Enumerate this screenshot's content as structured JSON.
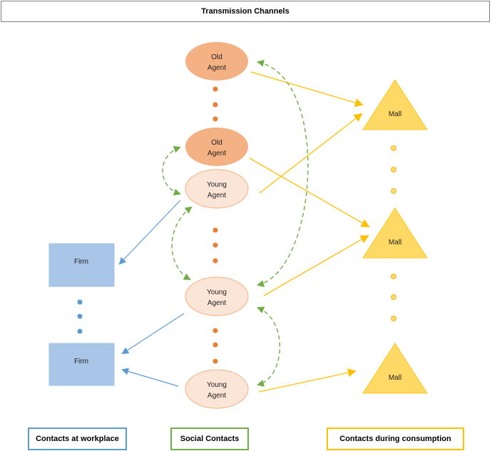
{
  "title": "Transmission Channels",
  "nodes": {
    "agents": [
      {
        "label_line1": "Old",
        "label_line2": "Agent",
        "type": "old"
      },
      {
        "label_line1": "Old",
        "label_line2": "Agent",
        "type": "old"
      },
      {
        "label_line1": "Young",
        "label_line2": "Agent",
        "type": "young"
      },
      {
        "label_line1": "Young",
        "label_line2": "Agent",
        "type": "young"
      },
      {
        "label_line1": "Young",
        "label_line2": "Agent",
        "type": "young"
      }
    ],
    "firms": [
      {
        "label": "Firm"
      },
      {
        "label": "Firm"
      }
    ],
    "malls": [
      {
        "label": "Mall"
      },
      {
        "label": "Mall"
      },
      {
        "label": "Mall"
      }
    ]
  },
  "legend": [
    {
      "label": "Contacts at workplace",
      "color": "#5b9bd5"
    },
    {
      "label": "Social Contacts",
      "color": "#70ad47"
    },
    {
      "label": "Contacts during consumption",
      "color": "#ffc000"
    }
  ],
  "colors": {
    "old_agent_fill": "#f4b183",
    "young_agent_fill": "#fbe5d6",
    "young_agent_stroke": "#f4b183",
    "agent_dots": "#ed7d31",
    "firm_fill": "#a9c6e8",
    "firm_dots": "#5b9bd5",
    "mall_fill": "#ffd966",
    "mall_dots": "#ffd966",
    "workplace_line": "#5b9bd5",
    "social_line": "#70ad47",
    "consumption_line": "#ffc000"
  }
}
